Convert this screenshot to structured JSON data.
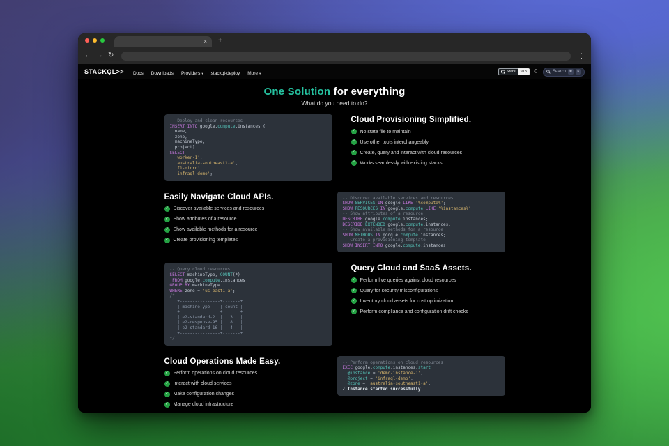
{
  "colors": {
    "accent": "#25c2a0",
    "check_green": "#25a244",
    "code_bg": "#2c323a",
    "syntax_keyword": "#c678dd",
    "syntax_type": "#56c2b8",
    "syntax_string": "#d7b56d",
    "syntax_comment": "#7d8590",
    "syntax_plain": "#c3cad4",
    "syntax_table": "#8b97a8"
  },
  "browser": {
    "tab_close_glyph": "×",
    "new_tab_glyph": "+",
    "back_glyph": "←",
    "forward_glyph": "→",
    "reload_glyph": "↻",
    "menu_glyph": "⋮",
    "address_value": ""
  },
  "navbar": {
    "brand": "STACKQL>>",
    "links": [
      {
        "label": "Docs",
        "caret": false
      },
      {
        "label": "Downloads",
        "caret": false
      },
      {
        "label": "Providers",
        "caret": true
      },
      {
        "label": "stackql-deploy",
        "caret": false
      },
      {
        "label": "More",
        "caret": true
      }
    ],
    "caret_glyph": "▾",
    "github": {
      "label": "Stars",
      "count": "918"
    },
    "theme_toggle_glyph": "☾",
    "search": {
      "placeholder": "Search",
      "key_mod": "⌘",
      "key_letter": "K"
    }
  },
  "hero": {
    "title_highlight": "One Solution",
    "title_rest": " for everything",
    "subtitle": "What do you need to do?"
  },
  "sections": [
    {
      "code_side": "left",
      "heading": "Cloud Provisioning Simplified.",
      "items": [
        "No state file to maintain",
        "Use other tools interchangeably",
        "Create, query and interact with cloud resources",
        "Works seamlessly with existing stacks"
      ],
      "code": {
        "lines": [
          [
            {
              "t": "-- Deploy and clean resources",
              "c": "com"
            }
          ],
          [
            {
              "t": "INSERT INTO ",
              "c": "kw"
            },
            {
              "t": "google.",
              "c": "pln"
            },
            {
              "t": "compute",
              "c": "typ"
            },
            {
              "t": ".instances (",
              "c": "pln"
            }
          ],
          [
            {
              "t": "  name,",
              "c": "pln"
            }
          ],
          [
            {
              "t": "  zone,",
              "c": "pln"
            }
          ],
          [
            {
              "t": "  machineType,",
              "c": "pln"
            }
          ],
          [
            {
              "t": "  project)",
              "c": "pln"
            }
          ],
          [
            {
              "t": "SELECT",
              "c": "kw"
            }
          ],
          [
            {
              "t": "  ",
              "c": "pln"
            },
            {
              "t": "'worker-1'",
              "c": "str"
            },
            {
              "t": ",",
              "c": "pln"
            }
          ],
          [
            {
              "t": "  ",
              "c": "pln"
            },
            {
              "t": "'australia-southeast1-a'",
              "c": "str"
            },
            {
              "t": ",",
              "c": "pln"
            }
          ],
          [
            {
              "t": "  ",
              "c": "pln"
            },
            {
              "t": "'f1-micro'",
              "c": "str"
            },
            {
              "t": ",",
              "c": "pln"
            }
          ],
          [
            {
              "t": "  ",
              "c": "pln"
            },
            {
              "t": "'infraql-demo'",
              "c": "str"
            },
            {
              "t": ";",
              "c": "pln"
            }
          ]
        ]
      }
    },
    {
      "code_side": "right",
      "heading": "Easily Navigate Cloud APIs.",
      "items": [
        "Discover available services and resources",
        "Show attributes of a resource",
        "Show available methods for a resource",
        "Create provisioning templates"
      ],
      "code": {
        "lines": [
          [
            {
              "t": "-- Discover available services and resources",
              "c": "com"
            }
          ],
          [
            {
              "t": "SHOW ",
              "c": "kw"
            },
            {
              "t": "SERVICES ",
              "c": "typ"
            },
            {
              "t": "IN ",
              "c": "kw"
            },
            {
              "t": "google ",
              "c": "pln"
            },
            {
              "t": "LIKE ",
              "c": "kw"
            },
            {
              "t": "'%compute%'",
              "c": "str"
            },
            {
              "t": ";",
              "c": "pln"
            }
          ],
          [
            {
              "t": "SHOW ",
              "c": "kw"
            },
            {
              "t": "RESOURCES ",
              "c": "typ"
            },
            {
              "t": "IN ",
              "c": "kw"
            },
            {
              "t": "google.",
              "c": "pln"
            },
            {
              "t": "compute ",
              "c": "typ"
            },
            {
              "t": "LIKE ",
              "c": "kw"
            },
            {
              "t": "'%instances%'",
              "c": "str"
            },
            {
              "t": ";",
              "c": "pln"
            }
          ],
          [
            {
              "t": "-- Show attributes of a resource",
              "c": "com"
            }
          ],
          [
            {
              "t": "DESCRIBE ",
              "c": "kw"
            },
            {
              "t": "google.",
              "c": "pln"
            },
            {
              "t": "compute",
              "c": "typ"
            },
            {
              "t": ".instances;",
              "c": "pln"
            }
          ],
          [
            {
              "t": "DESCRIBE ",
              "c": "kw"
            },
            {
              "t": "EXTENDED ",
              "c": "typ"
            },
            {
              "t": "google.",
              "c": "pln"
            },
            {
              "t": "compute",
              "c": "typ"
            },
            {
              "t": ".instances;",
              "c": "pln"
            }
          ],
          [
            {
              "t": "-- Show available methods for a resource",
              "c": "com"
            }
          ],
          [
            {
              "t": "SHOW ",
              "c": "kw"
            },
            {
              "t": "METHODS ",
              "c": "typ"
            },
            {
              "t": "IN ",
              "c": "kw"
            },
            {
              "t": "google.",
              "c": "pln"
            },
            {
              "t": "compute",
              "c": "typ"
            },
            {
              "t": ".instances;",
              "c": "pln"
            }
          ],
          [
            {
              "t": "-- Create a provisioning template",
              "c": "com"
            }
          ],
          [
            {
              "t": "SHOW INSERT INTO ",
              "c": "kw"
            },
            {
              "t": "google.",
              "c": "pln"
            },
            {
              "t": "compute",
              "c": "typ"
            },
            {
              "t": ".instances;",
              "c": "pln"
            }
          ]
        ]
      }
    },
    {
      "code_side": "left",
      "heading": "Query Cloud and SaaS Assets.",
      "items": [
        "Perform live queries against cloud resources",
        "Query for security misconfigurations",
        "Inventory cloud assets for cost optimization",
        "Perform compliance and configuration drift checks"
      ],
      "code": {
        "lines": [
          [
            {
              "t": "-- Query cloud resources",
              "c": "com"
            }
          ],
          [
            {
              "t": "SELECT ",
              "c": "kw"
            },
            {
              "t": "machineType, ",
              "c": "pln"
            },
            {
              "t": "COUNT",
              "c": "typ"
            },
            {
              "t": "(*)",
              "c": "pln"
            }
          ],
          [
            {
              "t": " ",
              "c": "pln"
            },
            {
              "t": "FROM ",
              "c": "kw"
            },
            {
              "t": "google.",
              "c": "pln"
            },
            {
              "t": "compute",
              "c": "typ"
            },
            {
              "t": ".instances",
              "c": "pln"
            }
          ],
          [
            {
              "t": "GROUP BY ",
              "c": "kw"
            },
            {
              "t": "machineType",
              "c": "pln"
            }
          ],
          [
            {
              "t": "WHERE ",
              "c": "kw"
            },
            {
              "t": "zone = ",
              "c": "pln"
            },
            {
              "t": "'us-east1-a'",
              "c": "str"
            },
            {
              "t": ";",
              "c": "pln"
            }
          ],
          [
            {
              "t": "/*",
              "c": "com"
            }
          ],
          [
            {
              "t": "   +----------------+-------+",
              "c": "tbl"
            }
          ],
          [
            {
              "t": "   | machineType    | count |",
              "c": "tbl"
            }
          ],
          [
            {
              "t": "   +----------------+-------+",
              "c": "tbl"
            }
          ],
          [
            {
              "t": "   | e2-standard-2  |   3   |",
              "c": "tbl"
            }
          ],
          [
            {
              "t": "   | e2-response-95 |   8   |",
              "c": "tbl"
            }
          ],
          [
            {
              "t": "   | e2-standard-16 |   4   |",
              "c": "tbl"
            }
          ],
          [
            {
              "t": "   +----------------+-------+",
              "c": "tbl"
            }
          ],
          [
            {
              "t": "*/",
              "c": "com"
            }
          ]
        ]
      }
    },
    {
      "code_side": "right",
      "heading": "Cloud Operations Made Easy.",
      "items": [
        "Perform operations on cloud resources",
        "Interact with cloud services",
        "Make configuration changes",
        "Manage cloud infrastructure"
      ],
      "code": {
        "lines": [
          [
            {
              "t": "-- Perform operations on cloud resources",
              "c": "com"
            }
          ],
          [
            {
              "t": "EXEC ",
              "c": "kw"
            },
            {
              "t": "google.",
              "c": "pln"
            },
            {
              "t": "compute",
              "c": "typ"
            },
            {
              "t": ".instances.",
              "c": "pln"
            },
            {
              "t": "start",
              "c": "typ"
            }
          ],
          [
            {
              "t": "  ",
              "c": "pln"
            },
            {
              "t": "@instance",
              "c": "typ"
            },
            {
              "t": " = ",
              "c": "pln"
            },
            {
              "t": "'demo-instance-1'",
              "c": "str"
            },
            {
              "t": ",",
              "c": "pln"
            }
          ],
          [
            {
              "t": "  ",
              "c": "pln"
            },
            {
              "t": "@project",
              "c": "typ"
            },
            {
              "t": " = ",
              "c": "pln"
            },
            {
              "t": "'infraql-demo'",
              "c": "str"
            },
            {
              "t": ",",
              "c": "pln"
            }
          ],
          [
            {
              "t": "  ",
              "c": "pln"
            },
            {
              "t": "@zone",
              "c": "typ"
            },
            {
              "t": " = ",
              "c": "pln"
            },
            {
              "t": "'australia-southeast1-a'",
              "c": "str"
            },
            {
              "t": ";",
              "c": "pln"
            }
          ],
          [
            {
              "t": "✓ Instance started successfully",
              "c": "ok"
            }
          ]
        ]
      }
    }
  ]
}
